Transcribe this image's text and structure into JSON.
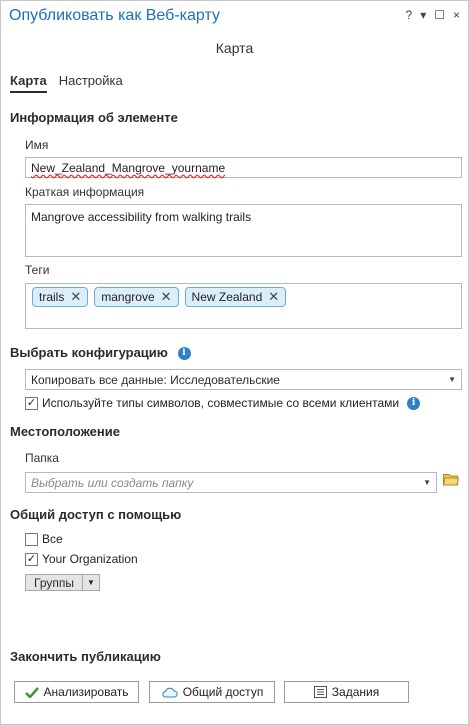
{
  "window": {
    "title": "Опубликовать как Веб-карту",
    "controls": {
      "help": "?",
      "menu": "▾",
      "maximize": "☐",
      "close": "×"
    }
  },
  "subtitle": "Карта",
  "tabs": [
    {
      "label": "Карта",
      "active": true
    },
    {
      "label": "Настройка",
      "active": false
    }
  ],
  "item_info": {
    "heading": "Информация об элементе",
    "name_label": "Имя",
    "name_value": "New_Zealand_Mangrove_yourname",
    "summary_label": "Краткая информация",
    "summary_value": "Mangrove accessibility from walking trails",
    "tags_label": "Теги",
    "tags": [
      "trails",
      "mangrove",
      "New Zealand"
    ]
  },
  "configuration": {
    "heading": "Выбрать конфигурацию",
    "selected": "Копировать все данные: Исследовательские",
    "compat_checkbox_label": "Используйте типы символов, совместимые со всеми клиентами",
    "compat_checked": true
  },
  "location": {
    "heading": "Местоположение",
    "folder_label": "Папка",
    "folder_placeholder": "Выбрать или создать папку"
  },
  "sharing": {
    "heading": "Общий доступ с помощью",
    "everyone_label": "Все",
    "everyone_checked": false,
    "org_label": "Your Organization",
    "org_checked": true,
    "groups_label": "Группы"
  },
  "finish": {
    "heading": "Закончить публикацию",
    "analyze_label": "Анализировать",
    "share_label": "Общий доступ",
    "jobs_label": "Задания"
  },
  "colors": {
    "accent": "#1d6fb8",
    "info": "#2f80c9",
    "chip_bg": "#dbeefa",
    "check_green": "#3a9a3a"
  }
}
